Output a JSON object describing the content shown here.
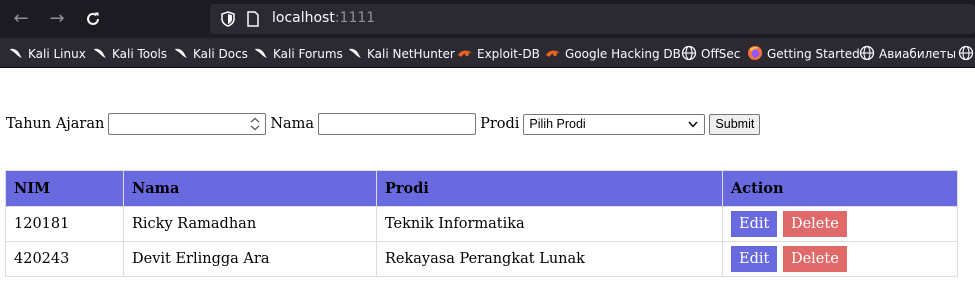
{
  "browser": {
    "url_host": "localhost",
    "url_port": ":1111",
    "bookmarks": [
      {
        "label": "Kali Linux",
        "icon": "kali-dragon-icon"
      },
      {
        "label": "Kali Tools",
        "icon": "kali-dragon-icon"
      },
      {
        "label": "Kali Docs",
        "icon": "kali-dragon-icon"
      },
      {
        "label": "Kali Forums",
        "icon": "kali-dragon-icon"
      },
      {
        "label": "Kali NetHunter",
        "icon": "kali-dragon-icon"
      },
      {
        "label": "Exploit-DB",
        "icon": "exploit-db-icon"
      },
      {
        "label": "Google Hacking DB",
        "icon": "exploit-db-icon"
      },
      {
        "label": "OffSec",
        "icon": "globe-icon"
      },
      {
        "label": "Getting Started",
        "icon": "firefox-icon"
      },
      {
        "label": "Авиабилеты",
        "icon": "globe-icon"
      }
    ]
  },
  "form": {
    "tahun_label": "Tahun Ajaran",
    "tahun_value": "",
    "nama_label": "Nama",
    "nama_value": "",
    "prodi_label": "Prodi",
    "prodi_selected": "Pilih Prodi",
    "submit_label": "Submit"
  },
  "table": {
    "headers": [
      "NIM",
      "Nama",
      "Prodi",
      "Action"
    ],
    "rows": [
      {
        "nim": "120181",
        "nama": "Ricky Ramadhan",
        "prodi": "Teknik Informatika"
      },
      {
        "nim": "420243",
        "nama": "Devit Erlingga Ara",
        "prodi": "Rekayasa Perangkat Lunak"
      }
    ],
    "edit_label": "Edit",
    "delete_label": "Delete"
  },
  "colors": {
    "header_bg": "#6a6ae0",
    "edit_bg": "#6a6ae0",
    "delete_bg": "#e06a6a",
    "chrome_bg": "#1c1b22"
  }
}
